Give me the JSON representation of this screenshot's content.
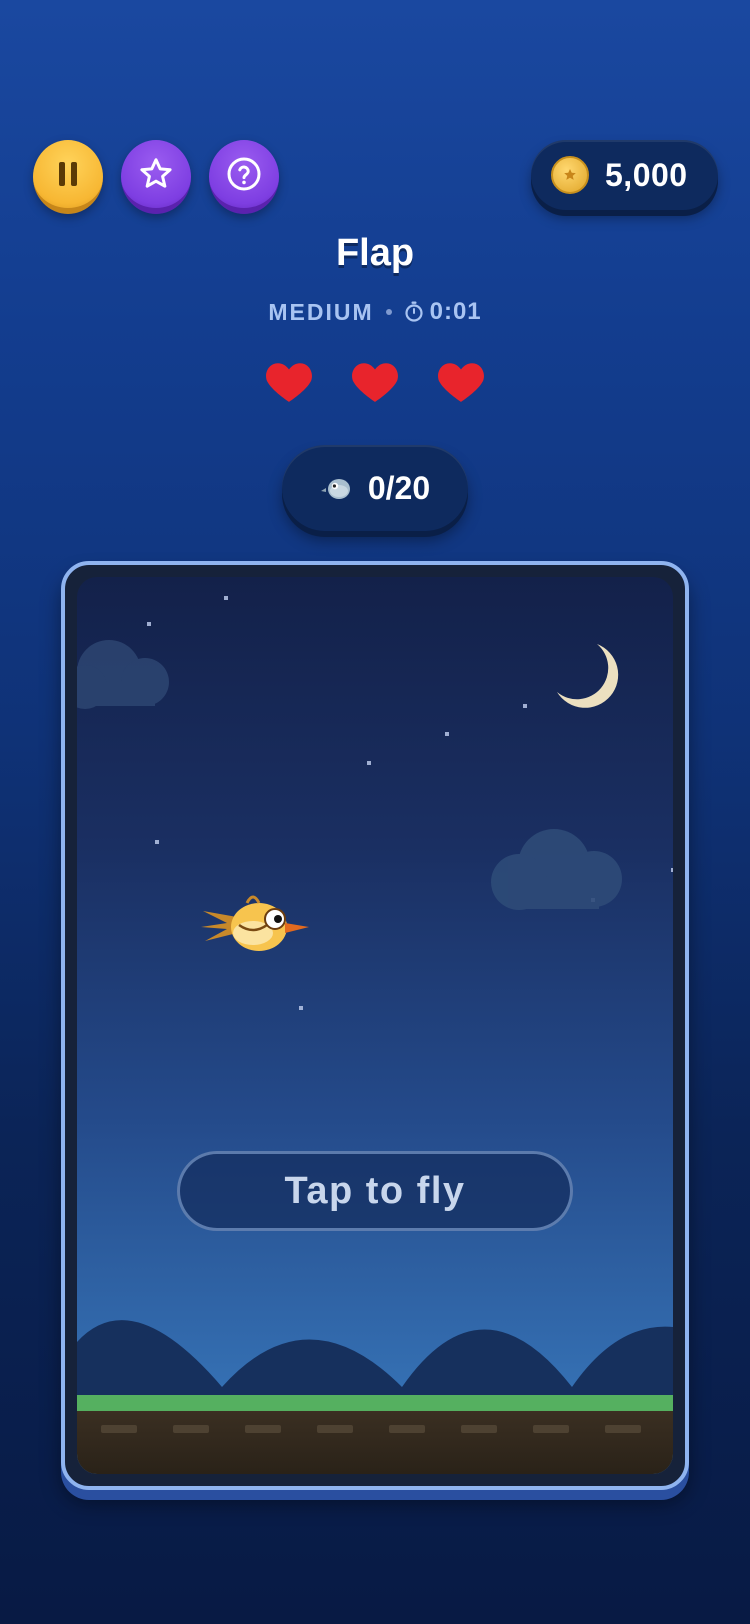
{
  "game": {
    "title": "Flap",
    "difficulty": "MEDIUM",
    "timer": "0:01",
    "lives": 3,
    "coins": "5,000",
    "score": "0/20",
    "tap_prompt": "Tap to fly"
  },
  "toolbar": {
    "pause_icon": "pause-icon",
    "star_icon": "star-icon",
    "help_icon": "help-icon"
  },
  "colors": {
    "pause_button": "#f7b733",
    "action_buttons": "#7e3ee2",
    "heart": "#e8242c",
    "grass": "#55b060"
  }
}
